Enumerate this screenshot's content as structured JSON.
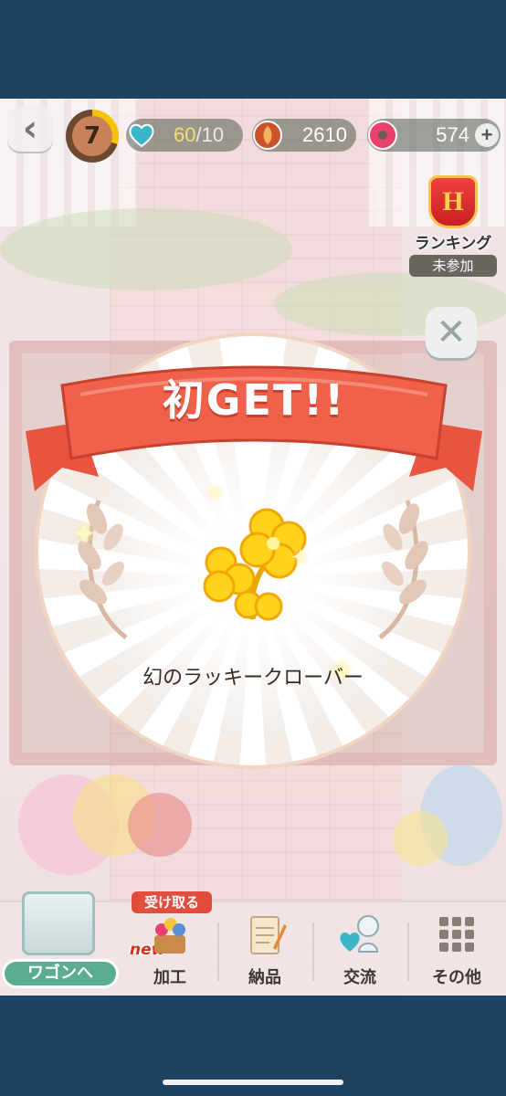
{
  "hud": {
    "level": "7",
    "stamina_current": "60",
    "stamina_max": "/10",
    "coins": "2610",
    "gems": "574"
  },
  "ranking": {
    "crown_letter": "H",
    "label": "ランキング",
    "status": "未参加"
  },
  "popup": {
    "banner_title": "初GET!!",
    "item_name": "幻のラッキークローバー"
  },
  "bottom_nav": {
    "wagon_label": "ワゴンへ",
    "receive_badge": "受け取る",
    "new_badge": "new",
    "items": [
      {
        "label": "加工",
        "icon": "flower-basket-icon"
      },
      {
        "label": "納品",
        "icon": "notepad-icon"
      },
      {
        "label": "交流",
        "icon": "friends-icon"
      },
      {
        "label": "その他",
        "icon": "grid-menu-icon"
      }
    ]
  },
  "colors": {
    "banner": "#f0614c",
    "accent_green": "#5aae8f",
    "frame": "#1e4261"
  }
}
